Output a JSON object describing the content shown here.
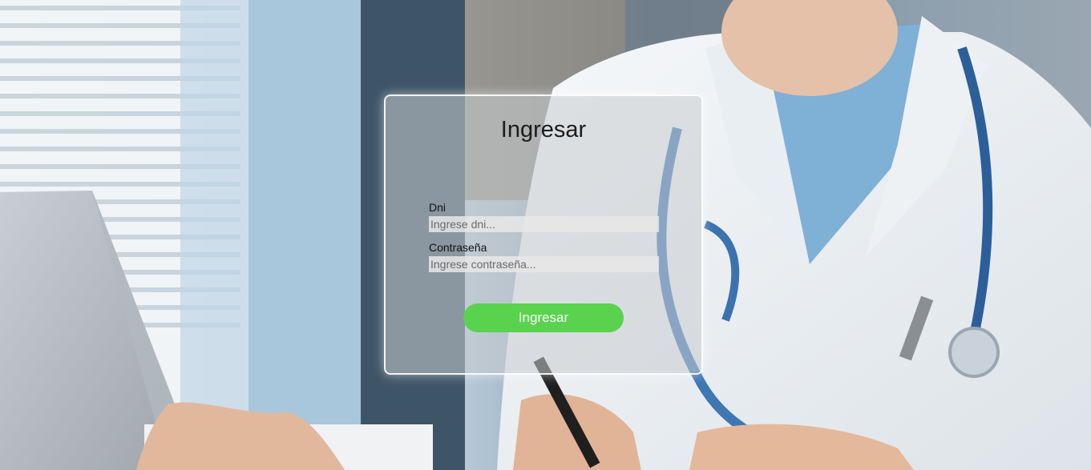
{
  "login": {
    "title": "Ingresar",
    "dni_label": "Dni",
    "dni_placeholder": "Ingrese dni...",
    "password_label": "Contraseña",
    "password_placeholder": "Ingrese contraseña...",
    "submit_label": "Ingresar"
  },
  "colors": {
    "submit_button": "#59d24e",
    "card_border": "#ffffff"
  }
}
